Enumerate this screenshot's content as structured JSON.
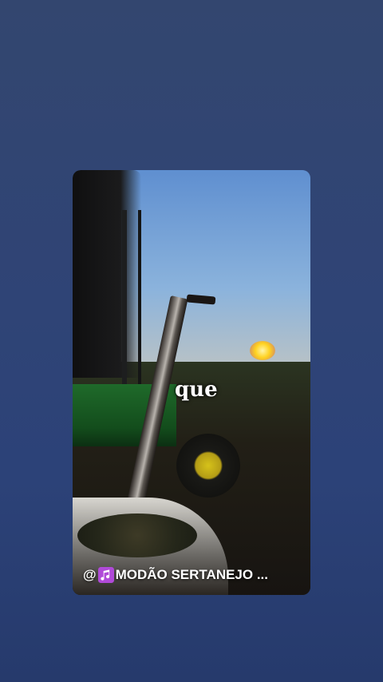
{
  "story": {
    "caption_word": "que",
    "music_at": "@",
    "music_label": "MODÃO SERTANEJO ..."
  },
  "colors": {
    "background": "#2f4476",
    "note_icon": "#b04ad8"
  },
  "icons": {
    "music": "music-note-icon"
  }
}
